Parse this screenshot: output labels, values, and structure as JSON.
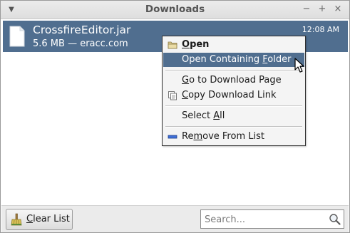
{
  "window": {
    "title": "Downloads",
    "controls": [
      "menu-icon",
      "minimize-icon",
      "maximize-icon",
      "close-icon"
    ]
  },
  "downloads": [
    {
      "name": "CrossfireEditor.jar",
      "meta": "5.6 MB — eracc.com",
      "time": "12:08 AM",
      "icon": "file-icon"
    }
  ],
  "context_menu": {
    "items": [
      {
        "label_pre": "",
        "label_u": "O",
        "label_post": "pen",
        "icon": "folder-icon"
      },
      {
        "label_pre": "Open Containing ",
        "label_u": "F",
        "label_post": "older",
        "highlighted": true
      },
      {
        "label_pre": "",
        "label_u": "G",
        "label_post": "o to Download Page"
      },
      {
        "label_pre": "",
        "label_u": "C",
        "label_post": "opy Download Link",
        "icon": "copy-link-icon"
      },
      {
        "label_pre": "Select ",
        "label_u": "A",
        "label_post": "ll"
      },
      {
        "label_pre": "Re",
        "label_u": "m",
        "label_post": "ove From List",
        "icon": "remove-icon"
      }
    ]
  },
  "bottom": {
    "clear_label_u": "C",
    "clear_label_post": "lear List",
    "clear_icon": "broom-icon",
    "search_placeholder": "Search...",
    "search_icon": "magnifier-icon"
  },
  "colors": {
    "selection": "#506e8f",
    "menu_bg": "#f4f4f4",
    "bottombar_bg": "#ebebeb"
  }
}
